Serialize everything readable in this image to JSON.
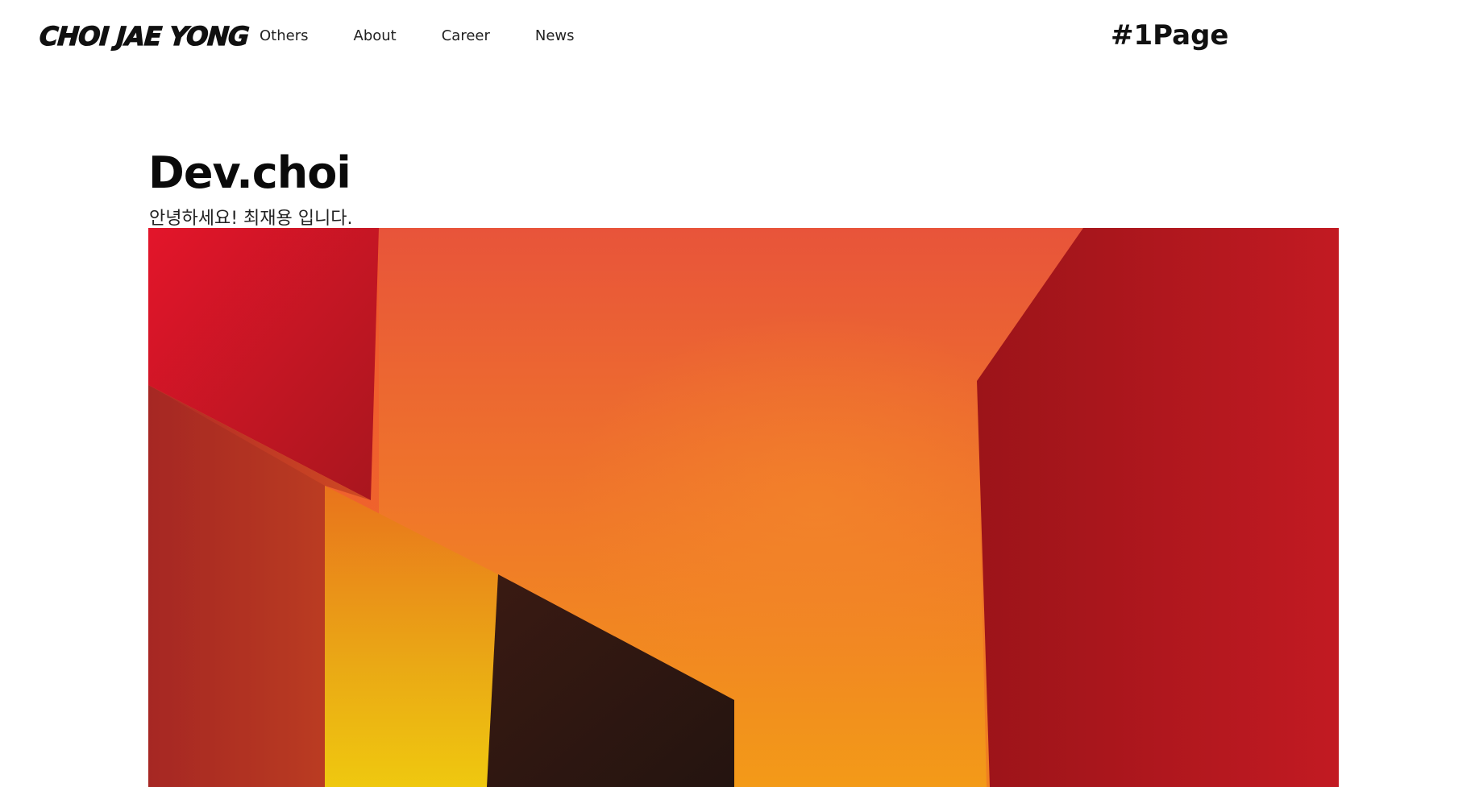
{
  "header": {
    "logo": "CHOI JAE YONG",
    "nav": [
      "Others",
      "About",
      "Career",
      "News"
    ],
    "page_tag": "#1Page"
  },
  "hero": {
    "title": "Dev.choi",
    "subtitle": "안녕하세요! 최재용 입니다."
  },
  "colors": {
    "image_red": "#e3152a",
    "image_orange": "#f0522e",
    "image_yellow": "#f5b21a",
    "image_dark": "#2a1612"
  }
}
